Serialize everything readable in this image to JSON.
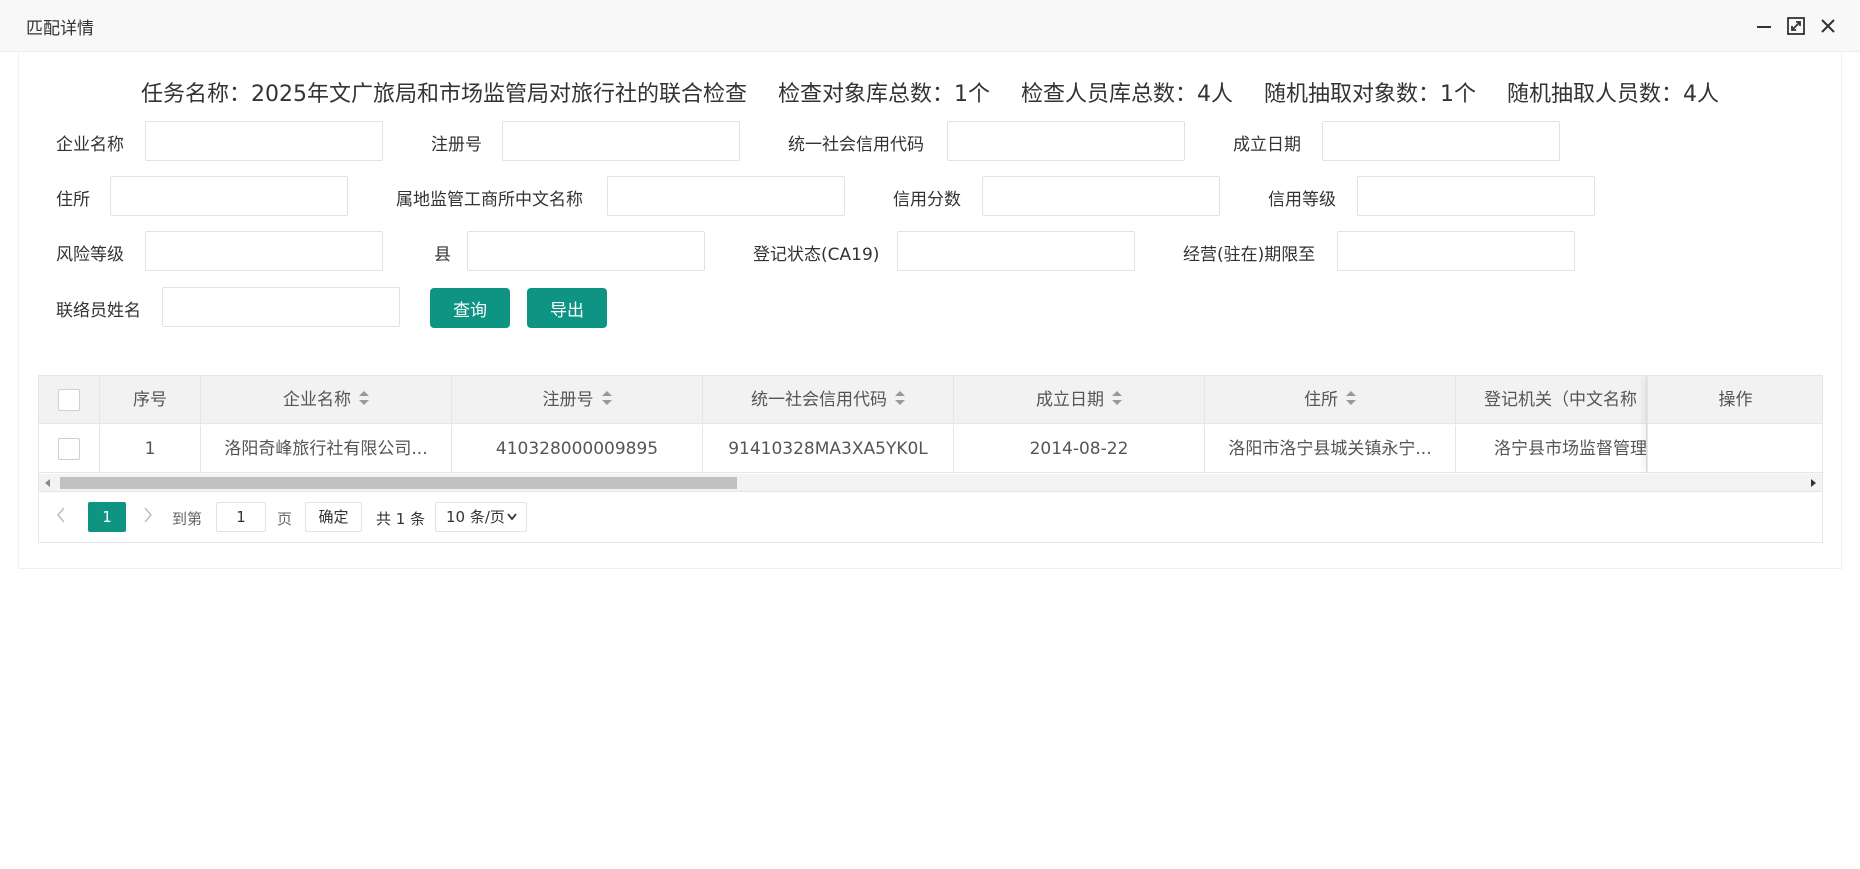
{
  "window": {
    "title": "匹配详情"
  },
  "summary": {
    "task_name": "任务名称：2025年文广旅局和市场监管局对旅行社的联合检查",
    "object_total": "检查对象库总数：1个",
    "personnel_total": "检查人员库总数：4人",
    "random_objects": "随机抽取对象数：1个",
    "random_personnel": "随机抽取人员数：4人"
  },
  "filters": {
    "company_name": "企业名称",
    "reg_no": "注册号",
    "credit_code": "统一社会信用代码",
    "found_date": "成立日期",
    "address": "住所",
    "supervision_office": "属地监管工商所中文名称",
    "credit_score": "信用分数",
    "credit_level": "信用等级",
    "risk_level": "风险等级",
    "county": "县",
    "reg_status": "登记状态(CA19)",
    "operation_term": "经营(驻在)期限至",
    "liaison_name": "联络员姓名"
  },
  "buttons": {
    "query": "查询",
    "export": "导出"
  },
  "table": {
    "headers": {
      "index": "序号",
      "company_name": "企业名称",
      "reg_no": "注册号",
      "credit_code": "统一社会信用代码",
      "found_date": "成立日期",
      "address": "住所",
      "reg_authority": "登记机关（中文名称",
      "operation": "操作"
    },
    "rows": [
      {
        "index": "1",
        "company_name": "洛阳奇峰旅行社有限公司...",
        "reg_no": "410328000009895",
        "credit_code": "91410328MA3XA5YK0L",
        "found_date": "2014-08-22",
        "address": "洛阳市洛宁县城关镇永宁...",
        "reg_authority": "洛宁县市场监督管理"
      }
    ]
  },
  "pager": {
    "current_page": "1",
    "goto_label": "到第",
    "goto_value": "1",
    "page_unit": "页",
    "confirm": "确定",
    "total": "共 1 条",
    "page_size": "10 条/页"
  },
  "colors": {
    "accent": "#0f9484"
  }
}
